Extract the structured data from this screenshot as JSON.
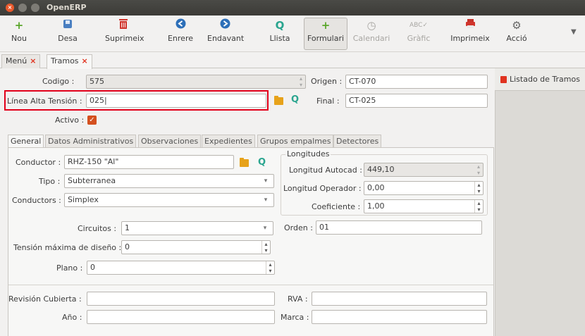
{
  "window": {
    "title": "OpenERP"
  },
  "toolbar": {
    "nou": "Nou",
    "desa": "Desa",
    "suprimeix": "Suprimeix",
    "enrere": "Enrere",
    "endavant": "Endavant",
    "llista": "Llista",
    "formulari": "Formulari",
    "calendari": "Calendari",
    "grafic": "Gràfic",
    "imprimeix": "Imprimeix",
    "accio": "Acció"
  },
  "tabs": [
    {
      "label": "Menú",
      "close": "×"
    },
    {
      "label": "Tramos",
      "close": "×"
    }
  ],
  "form": {
    "codigo": {
      "label": "Codigo :",
      "value": "575"
    },
    "origen": {
      "label": "Origen :",
      "value": "CT-070"
    },
    "linea": {
      "label": "Línea Alta Tensión :",
      "value": "025"
    },
    "final": {
      "label": "Final :",
      "value": "CT-025"
    },
    "activo": {
      "label": "Activo :",
      "checked": true
    }
  },
  "subtabs": [
    "General",
    "Datos Administrativos",
    "Observaciones",
    "Expedientes",
    "Grupos empalmes",
    "Detectores"
  ],
  "general": {
    "conductor": {
      "label": "Conductor :",
      "value": "RHZ-150 \"Al\""
    },
    "tipo": {
      "label": "Tipo :",
      "value": "Subterranea"
    },
    "conductores": {
      "label": "Conductors :",
      "value": "Simplex"
    },
    "longitudes_title": "Longitudes",
    "long_autocad": {
      "label": "Longitud Autocad :",
      "value": "449,10"
    },
    "long_operador": {
      "label": "Longitud Operador :",
      "value": "0,00"
    },
    "coeficiente": {
      "label": "Coeficiente :",
      "value": "1,00"
    },
    "circuitos": {
      "label": "Circuitos :",
      "value": "1"
    },
    "orden": {
      "label": "Orden :",
      "value": "01"
    },
    "tension": {
      "label": "Tensión máxima de diseño :",
      "value": "0"
    },
    "plano": {
      "label": "Plano :",
      "value": "0"
    },
    "revision": {
      "label": "Revisión Cubierta :",
      "value": ""
    },
    "rva": {
      "label": "RVA :",
      "value": ""
    },
    "anio": {
      "label": "Año :",
      "value": ""
    },
    "marca": {
      "label": "Marca :",
      "value": ""
    }
  },
  "sidebar": {
    "item": "Listado de Tramos"
  },
  "colors": {
    "accent": "#e0321f",
    "highlight_box": "#e2001a",
    "search": "#2aa58f"
  }
}
